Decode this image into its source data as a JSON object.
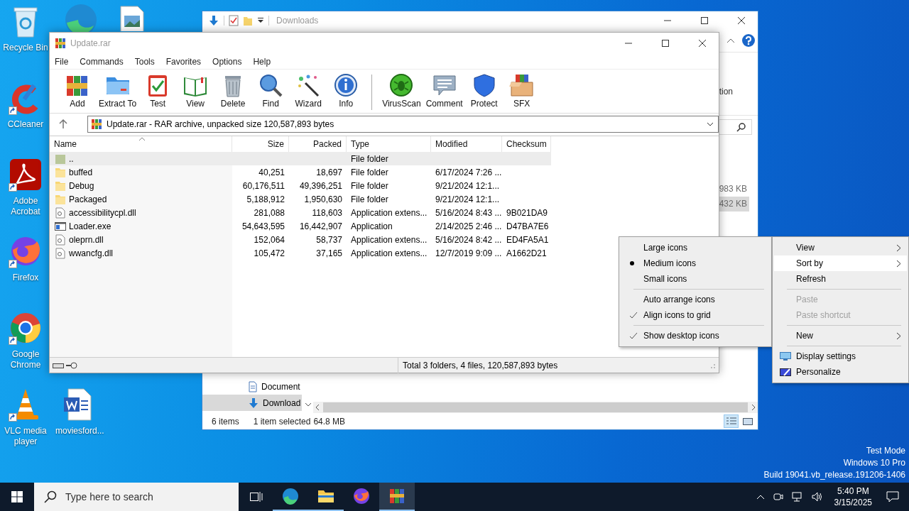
{
  "desktop_icons": [
    {
      "label": "Recycle Bin",
      "shortcut": false
    },
    {
      "label": "CCleaner",
      "shortcut": true
    },
    {
      "label": "Adobe Acrobat",
      "shortcut": true
    },
    {
      "label": "Firefox",
      "shortcut": true
    },
    {
      "label": "Google Chrome",
      "shortcut": true
    },
    {
      "label": "VLC media player",
      "shortcut": true
    },
    {
      "label": "moviesford...",
      "shortcut": false
    }
  ],
  "explorer": {
    "title": "Downloads",
    "ribbon_label_partial": "tion",
    "files": [
      {
        "size": "983 KB",
        "selected": false
      },
      {
        "size": "432 KB",
        "selected": true
      }
    ],
    "nav_items": [
      {
        "label": "Document",
        "selected": false
      },
      {
        "label": "Download",
        "selected": true
      }
    ],
    "status": {
      "item_count": "6 items",
      "selection": "1 item selected",
      "selection_size": "64.8 MB"
    }
  },
  "winrar": {
    "title": "Update.rar",
    "menu": [
      "File",
      "Commands",
      "Tools",
      "Favorites",
      "Options",
      "Help"
    ],
    "toolbar": [
      {
        "kind": "tool",
        "label": "Add"
      },
      {
        "kind": "tool",
        "label": "Extract To"
      },
      {
        "kind": "tool",
        "label": "Test"
      },
      {
        "kind": "tool",
        "label": "View"
      },
      {
        "kind": "tool",
        "label": "Delete"
      },
      {
        "kind": "tool",
        "label": "Find"
      },
      {
        "kind": "tool",
        "label": "Wizard"
      },
      {
        "kind": "tool",
        "label": "Info"
      },
      {
        "kind": "separator"
      },
      {
        "kind": "tool",
        "label": "VirusScan"
      },
      {
        "kind": "tool",
        "label": "Comment"
      },
      {
        "kind": "tool",
        "label": "Protect"
      },
      {
        "kind": "tool",
        "label": "SFX"
      }
    ],
    "address": "Update.rar - RAR archive, unpacked size 120,587,893 bytes",
    "columns": [
      "Name",
      "Size",
      "Packed",
      "Type",
      "Modified",
      "Checksum"
    ],
    "rows": [
      {
        "kind": "parent",
        "name": "..",
        "type": "File folder",
        "focused": true
      },
      {
        "kind": "folder",
        "name": "buffed",
        "size": "40,251",
        "packed": "18,697",
        "type": "File folder",
        "modified": "6/17/2024 7:26 ...",
        "focused": false
      },
      {
        "kind": "folder",
        "name": "Debug",
        "size": "60,176,511",
        "packed": "49,396,251",
        "type": "File folder",
        "modified": "9/21/2024 12:1...",
        "focused": false
      },
      {
        "kind": "folder",
        "name": "Packaged",
        "size": "5,188,912",
        "packed": "1,950,630",
        "type": "File folder",
        "modified": "9/21/2024 12:1...",
        "focused": false
      },
      {
        "kind": "dll",
        "name": "accessibilitycpl.dll",
        "size": "281,088",
        "packed": "118,603",
        "type": "Application extens...",
        "modified": "5/16/2024 8:43 ...",
        "checksum": "9B021DA9",
        "focused": false
      },
      {
        "kind": "exe",
        "name": "Loader.exe",
        "size": "54,643,595",
        "packed": "16,442,907",
        "type": "Application",
        "modified": "2/14/2025 2:46 ...",
        "checksum": "D47BA7E6",
        "focused": false
      },
      {
        "kind": "dll",
        "name": "oleprn.dll",
        "size": "152,064",
        "packed": "58,737",
        "type": "Application extens...",
        "modified": "5/16/2024 8:42 ...",
        "checksum": "ED4FA5A1",
        "focused": false
      },
      {
        "kind": "dll",
        "name": "wwancfg.dll",
        "size": "105,472",
        "packed": "37,165",
        "type": "Application extens...",
        "modified": "12/7/2019 9:09 ...",
        "checksum": "A1662D21",
        "focused": false
      }
    ],
    "status": "Total 3 folders, 4 files, 120,587,893 bytes"
  },
  "view_submenu": {
    "items": [
      {
        "kind": "radio",
        "label": "Large icons",
        "selected": false
      },
      {
        "kind": "radio",
        "label": "Medium icons",
        "selected": true
      },
      {
        "kind": "radio",
        "label": "Small icons",
        "selected": false
      },
      {
        "kind": "separator"
      },
      {
        "kind": "check",
        "label": "Auto arrange icons",
        "checked": false
      },
      {
        "kind": "check",
        "label": "Align icons to grid",
        "checked": true
      },
      {
        "kind": "separator"
      },
      {
        "kind": "check",
        "label": "Show desktop icons",
        "checked": true
      }
    ]
  },
  "context_menu": {
    "items": [
      {
        "kind": "item",
        "label": "View",
        "submenu": true,
        "highlighted": false,
        "disabled": false
      },
      {
        "kind": "item",
        "label": "Sort by",
        "submenu": true,
        "highlighted": true,
        "disabled": false
      },
      {
        "kind": "item",
        "label": "Refresh",
        "submenu": false,
        "highlighted": false,
        "disabled": false
      },
      {
        "kind": "separator"
      },
      {
        "kind": "item",
        "label": "Paste",
        "submenu": false,
        "highlighted": false,
        "disabled": true
      },
      {
        "kind": "item",
        "label": "Paste shortcut",
        "submenu": false,
        "highlighted": false,
        "disabled": true
      },
      {
        "kind": "separator"
      },
      {
        "kind": "item",
        "label": "New",
        "submenu": true,
        "highlighted": false,
        "disabled": false
      },
      {
        "kind": "separator"
      },
      {
        "kind": "icon_item",
        "label": "Display settings",
        "submenu": false,
        "highlighted": false,
        "disabled": false
      },
      {
        "kind": "icon_item",
        "label": "Personalize",
        "submenu": false,
        "highlighted": false,
        "disabled": false
      }
    ]
  },
  "os_watermark": [
    "Test Mode",
    "Windows 10 Pro",
    "Build 19041.vb_release.191206-1406"
  ],
  "taskbar": {
    "search_placeholder": "Type here to search",
    "apps": [
      {
        "running": true,
        "selected": false
      },
      {
        "running": true,
        "selected": false
      },
      {
        "running": false,
        "selected": false
      },
      {
        "running": true,
        "selected": true
      }
    ],
    "clock": {
      "time": "5:40 PM",
      "date": "3/15/2025"
    }
  }
}
